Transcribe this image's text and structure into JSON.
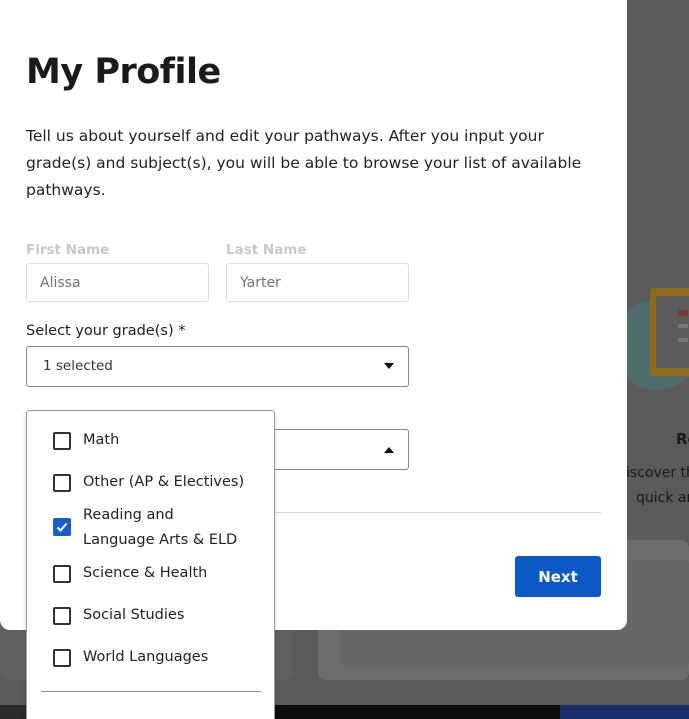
{
  "modal": {
    "title": "My Profile",
    "description": "Tell us about yourself and edit your pathways. After you input your grade(s) and subject(s), you will be able to browse your list of available pathways."
  },
  "fields": {
    "first_name": {
      "label": "First Name",
      "placeholder": "Alissa"
    },
    "last_name": {
      "label": "Last Name",
      "placeholder": "Yarter"
    }
  },
  "grade": {
    "label": "Select your grade(s) *",
    "value": "1 selected"
  },
  "subject_dropdown": {
    "options": [
      {
        "label": "Math",
        "checked": false
      },
      {
        "label": "Other (AP & Electives)",
        "checked": false
      },
      {
        "label": "Reading and",
        "label_line2": "Language Arts & ELD",
        "checked": true
      },
      {
        "label": "Science & Health",
        "checked": false
      },
      {
        "label": "Social Studies",
        "checked": false
      },
      {
        "label": "World Languages",
        "checked": false
      }
    ]
  },
  "actions": {
    "next_label": "Next"
  },
  "background": {
    "card_title": "Re",
    "card_line1": "iscover th",
    "card_line2": "quick ar"
  },
  "colors": {
    "accent": "#0d58c5",
    "checkbox_checked": "#1a5fc8"
  }
}
